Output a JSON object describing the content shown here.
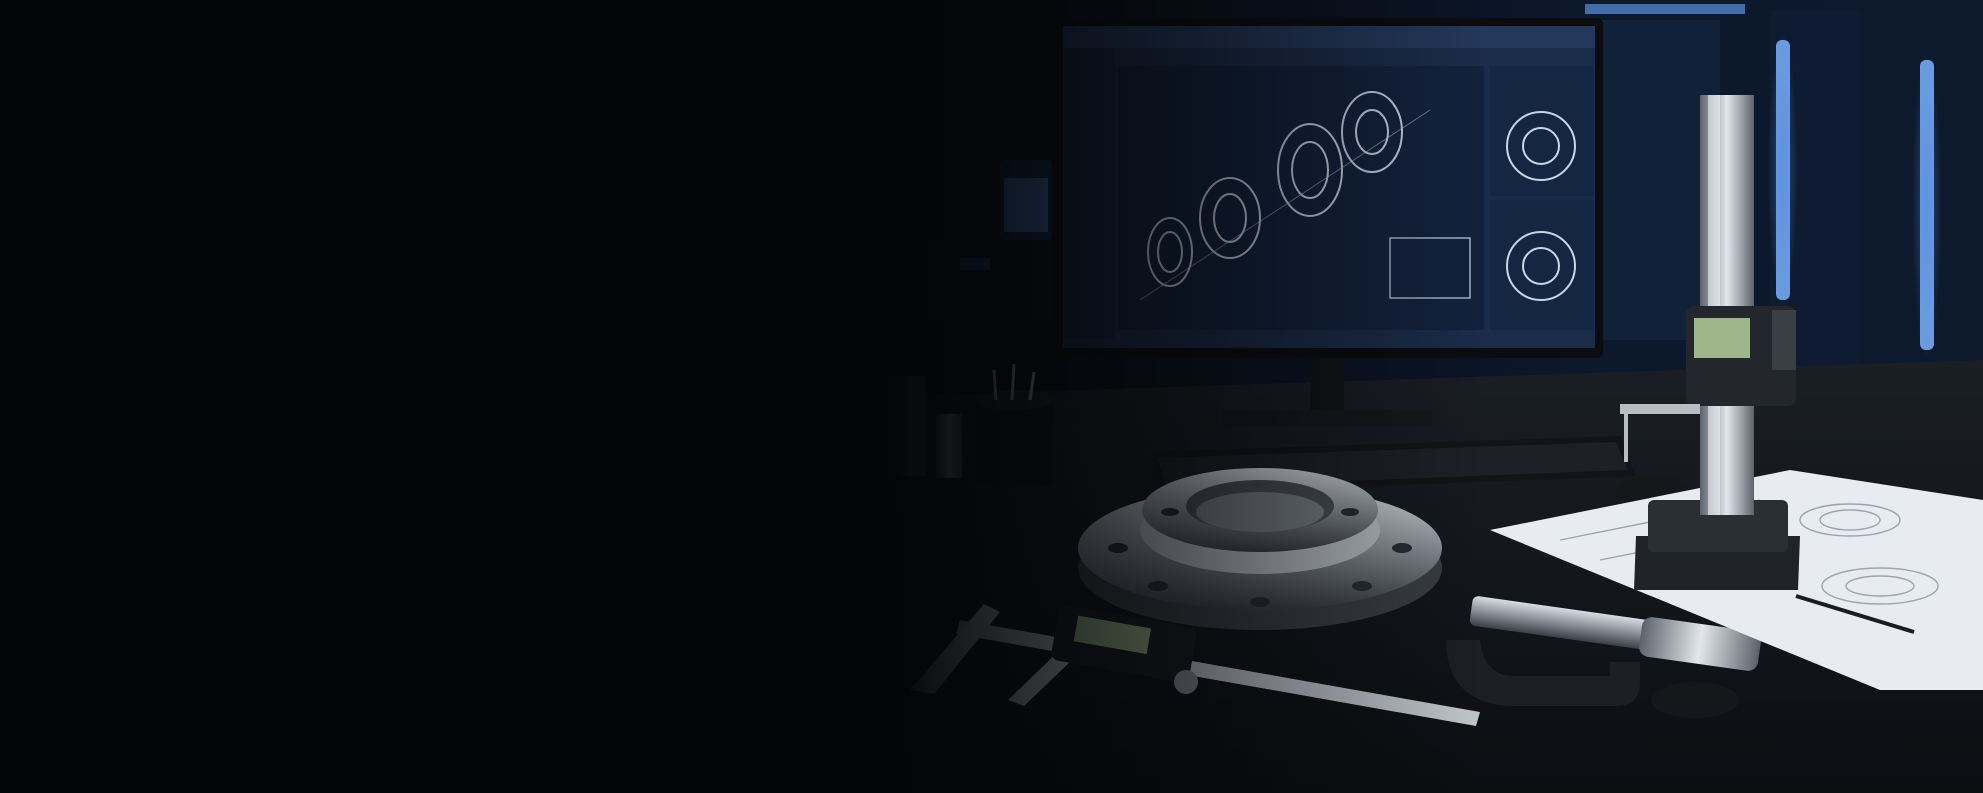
{
  "scene": {
    "kind": "photo",
    "subject": "dark-engineering-workspace",
    "accent_color": "#3f7fff",
    "background_color": "#050608"
  }
}
